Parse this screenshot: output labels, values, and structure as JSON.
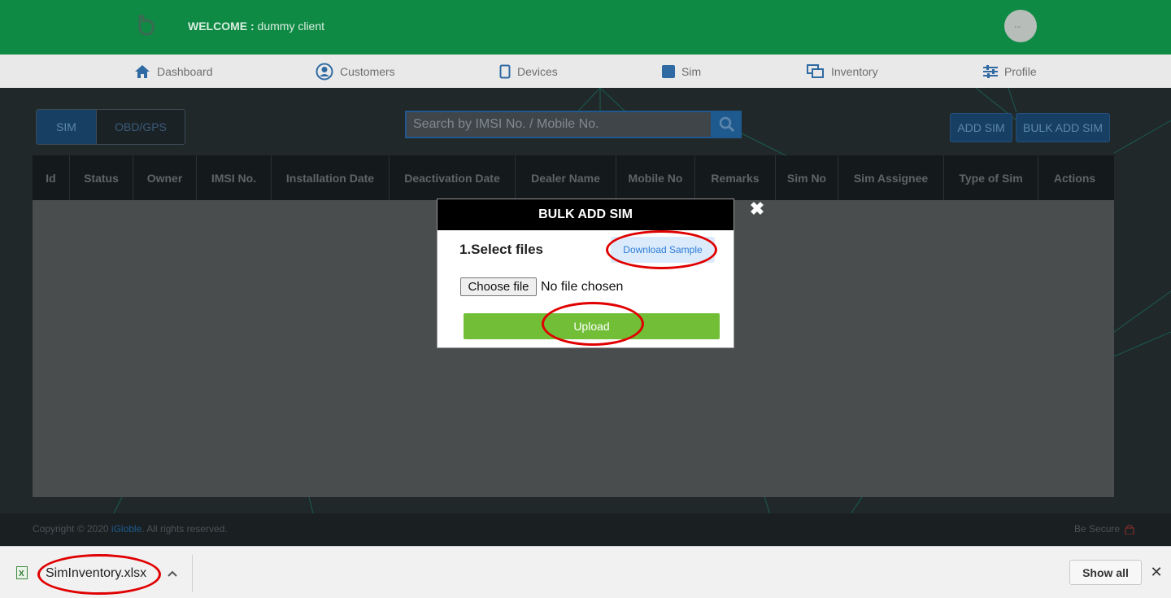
{
  "header": {
    "welcome_label": "WELCOME :",
    "welcome_user": "dummy client",
    "avatar_text": "↔"
  },
  "nav": {
    "items": [
      {
        "label": "Dashboard",
        "icon": "home-icon"
      },
      {
        "label": "Customers",
        "icon": "user-circle-icon"
      },
      {
        "label": "Devices",
        "icon": "device-icon"
      },
      {
        "label": "Sim",
        "icon": "sim-icon"
      },
      {
        "label": "Inventory",
        "icon": "inventory-icon"
      },
      {
        "label": "Profile",
        "icon": "sliders-icon"
      }
    ]
  },
  "toolbar": {
    "tabs": [
      "SIM",
      "OBD/GPS"
    ],
    "search_placeholder": "Search by IMSI No. / Mobile No.",
    "add_sim": "ADD SIM",
    "bulk_add_sim": "BULK ADD SIM"
  },
  "table": {
    "columns": [
      "Id",
      "Status",
      "Owner",
      "IMSI No.",
      "Installation Date",
      "Deactivation Date",
      "Dealer Name",
      "Mobile No",
      "Remarks",
      "Sim No",
      "Sim Assignee",
      "Type of Sim",
      "Actions"
    ],
    "rows": []
  },
  "modal": {
    "title": "BULK ADD SIM",
    "select_label": "1.Select files",
    "download_sample": "Download Sample",
    "choose_file": "Choose file",
    "no_file": "No file chosen",
    "upload": "Upload",
    "close": "✖"
  },
  "footer": {
    "copyright_prefix": "Copyright © 2020",
    "company": "iGloble",
    "copyright_suffix": ". All rights reserved.",
    "secure": "Be Secure"
  },
  "download_bar": {
    "filename": "SimInventory.xlsx",
    "show_all": "Show all",
    "close": "✕"
  },
  "colors": {
    "header_green": "#0f8a45",
    "upload_green": "#72bf37",
    "annotation_red": "#e00000",
    "link_blue": "#2b7bd6"
  }
}
